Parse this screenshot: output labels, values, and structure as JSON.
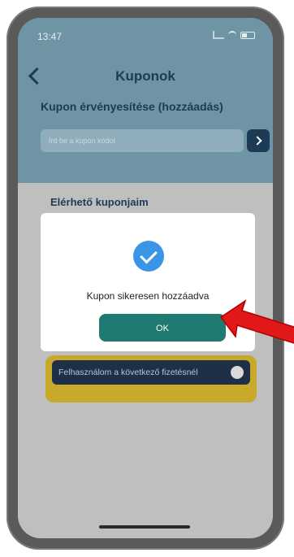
{
  "status": {
    "time": "13:47"
  },
  "header": {
    "title": "Kuponok"
  },
  "redeem": {
    "title": "Kupon érvényesítése (hozzáadás)",
    "placeholder": "Írd be a kupon kódot"
  },
  "available": {
    "title": "Elérhető kuponjaim"
  },
  "coupon": {
    "action_text": "Felhasználom a következő fizetésnél"
  },
  "modal": {
    "message": "Kupon sikeresen hozzáadva",
    "ok_label": "OK"
  },
  "colors": {
    "primary": "#1e3b55",
    "accent_green": "#1f7a72",
    "success_blue": "#3b95e6",
    "coupon_gold": "#c8a92a",
    "annotation_red": "#e01818"
  }
}
